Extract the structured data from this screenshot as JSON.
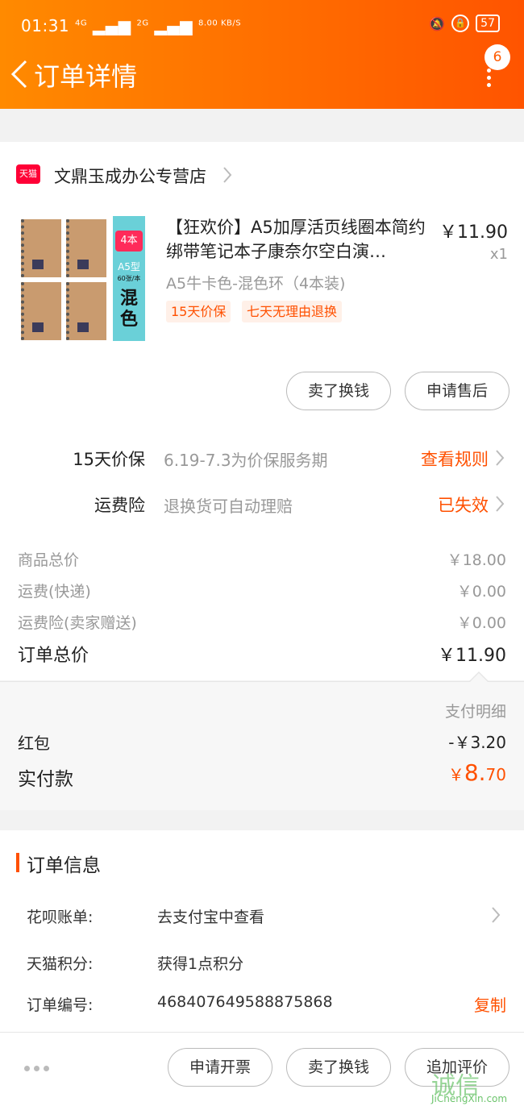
{
  "status_bar": {
    "time": "01:31",
    "net1": "4G",
    "net2": "2G",
    "speed": "8.00 KB/S",
    "battery": "57"
  },
  "header": {
    "title": "订单详情",
    "badge": "6"
  },
  "store": {
    "name": "文鼎玉成办公专营店",
    "logo_text": "天猫"
  },
  "product": {
    "title": "【狂欢价】A5加厚活页线圈本简约绑带笔记本子康奈尔空白演…",
    "price": "￥11.90",
    "qty": "x1",
    "sku": "A5牛卡色-混色环（4本装)",
    "tags": [
      "15天价保",
      "七天无理由退换"
    ],
    "thumb": {
      "count": "4本",
      "size": "A5型",
      "sheets": "60张/本",
      "color": "混色"
    }
  },
  "item_buttons": {
    "sell": "卖了换钱",
    "after_sale": "申请售后"
  },
  "services": [
    {
      "label": "15天价保",
      "desc": "6.19-7.3为价保服务期",
      "action": "查看规则"
    },
    {
      "label": "运费险",
      "desc": "退换货可自动理赔",
      "action": "已失效"
    }
  ],
  "fees": [
    {
      "label": "商品总价",
      "value": "￥18.00"
    },
    {
      "label": "运费(快递)",
      "value": "￥0.00"
    },
    {
      "label": "运费险(卖家赠送)",
      "value": "￥0.00"
    }
  ],
  "total": {
    "label": "订单总价",
    "value": "￥11.90"
  },
  "payment": {
    "detail_link": "支付明细",
    "red_packet_label": "红包",
    "red_packet_value": "-￥3.20",
    "paid_label": "实付款",
    "paid_currency": "￥",
    "paid_int": "8.",
    "paid_dec": "70"
  },
  "order_info": {
    "title": "订单信息",
    "rows": [
      {
        "key": "花呗账单:",
        "value": "去支付宝中查看"
      },
      {
        "key": "天猫积分:",
        "value": "获得1点积分"
      },
      {
        "key": "订单编号:",
        "value": "468407649588875868",
        "action": "复制"
      }
    ]
  },
  "bottom_bar": {
    "invoice": "申请开票",
    "sell": "卖了换钱",
    "review": "追加评价"
  },
  "watermark": {
    "big": "诚信",
    "small": "JiChengXin.com"
  },
  "colors": {
    "accent": "#ff5000",
    "header_start": "#ff8a00",
    "header_end": "#ff5400"
  }
}
